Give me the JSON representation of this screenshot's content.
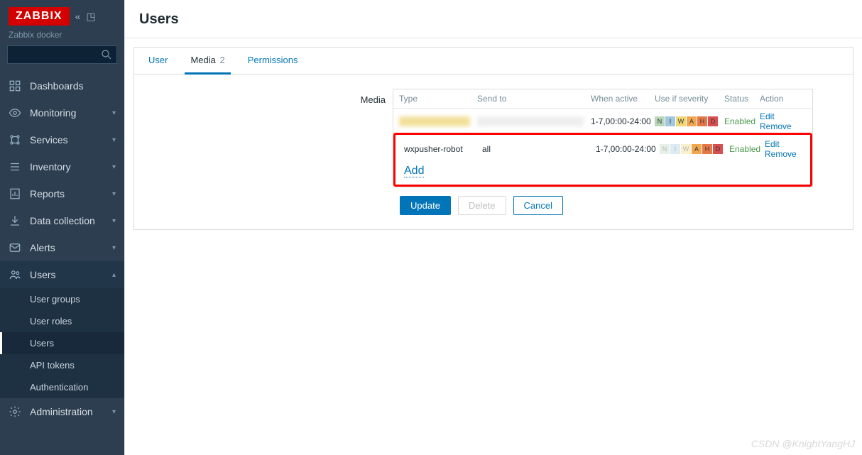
{
  "header": {
    "logo": "ZABBIX",
    "subtitle": "Zabbix docker",
    "search_placeholder": ""
  },
  "sidebar": [
    {
      "icon": "dashboards",
      "label": "Dashboards",
      "caret": false
    },
    {
      "icon": "monitoring",
      "label": "Monitoring",
      "caret": true
    },
    {
      "icon": "services",
      "label": "Services",
      "caret": true
    },
    {
      "icon": "inventory",
      "label": "Inventory",
      "caret": true
    },
    {
      "icon": "reports",
      "label": "Reports",
      "caret": true
    },
    {
      "icon": "data",
      "label": "Data collection",
      "caret": true
    },
    {
      "icon": "alerts",
      "label": "Alerts",
      "caret": true
    },
    {
      "icon": "users",
      "label": "Users",
      "caret": true,
      "active": true
    },
    {
      "icon": "admin",
      "label": "Administration",
      "caret": true
    }
  ],
  "subnav": [
    {
      "label": "User groups"
    },
    {
      "label": "User roles"
    },
    {
      "label": "Users",
      "active": true
    },
    {
      "label": "API tokens"
    },
    {
      "label": "Authentication"
    }
  ],
  "page": {
    "title": "Users"
  },
  "tabs": [
    {
      "label": "User"
    },
    {
      "label": "Media",
      "count": "2",
      "active": true
    },
    {
      "label": "Permissions"
    }
  ],
  "media": {
    "label": "Media",
    "headers": {
      "type": "Type",
      "send": "Send to",
      "when": "When active",
      "sev": "Use if severity",
      "status": "Status",
      "action": "Action"
    },
    "rows": [
      {
        "type_hidden": true,
        "send_hidden": true,
        "when": "1-7,00:00-24:00",
        "sev_dim": false,
        "status": "Enabled",
        "edit": "Edit",
        "remove": "Remove"
      },
      {
        "type": "wxpusher-robot",
        "send": "all",
        "when": "1-7,00:00-24:00",
        "sev_dim": true,
        "status": "Enabled",
        "edit": "Edit",
        "remove": "Remove",
        "highlighted": true
      }
    ],
    "severities": [
      {
        "l": "N",
        "c": "#b8d6b8"
      },
      {
        "l": "I",
        "c": "#a1c7e0"
      },
      {
        "l": "W",
        "c": "#f0d775"
      },
      {
        "l": "A",
        "c": "#f0a850"
      },
      {
        "l": "H",
        "c": "#e67848"
      },
      {
        "l": "D",
        "c": "#d94f4f"
      }
    ],
    "add": "Add"
  },
  "buttons": {
    "update": "Update",
    "delete": "Delete",
    "cancel": "Cancel"
  },
  "watermark": "CSDN @KnightYangHJ"
}
